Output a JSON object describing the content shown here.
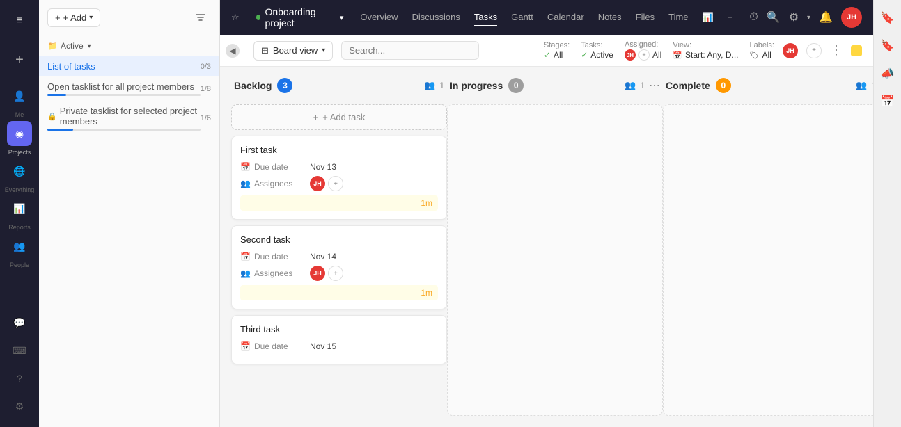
{
  "app": {
    "title": "Onboarding project"
  },
  "topNav": {
    "links": [
      {
        "id": "overview",
        "label": "Overview"
      },
      {
        "id": "discussions",
        "label": "Discussions"
      },
      {
        "id": "tasks",
        "label": "Tasks",
        "active": true
      },
      {
        "id": "gantt",
        "label": "Gantt"
      },
      {
        "id": "calendar",
        "label": "Calendar"
      },
      {
        "id": "notes",
        "label": "Notes"
      },
      {
        "id": "files",
        "label": "Files"
      },
      {
        "id": "time",
        "label": "Time"
      }
    ],
    "user": "JH"
  },
  "sidebar": {
    "addButton": "+ Add",
    "activeFilter": "Active",
    "items": [
      {
        "id": "list-of-tasks",
        "label": "List of tasks",
        "count": "0/3",
        "active": true,
        "locked": false
      },
      {
        "id": "open-tasklist",
        "label": "Open tasklist for all project members",
        "count": "1/8",
        "active": false,
        "locked": false
      },
      {
        "id": "private-tasklist",
        "label": "Private tasklist for selected project members",
        "count": "1/6",
        "active": false,
        "locked": true
      }
    ]
  },
  "board": {
    "viewLabel": "Board view",
    "searchPlaceholder": "Search...",
    "filters": {
      "stages": {
        "label": "Stages:",
        "value": "All"
      },
      "tasks": {
        "label": "Tasks:",
        "value": "Active"
      },
      "assigned": {
        "label": "Assigned:",
        "value": "All"
      },
      "view": {
        "label": "View:",
        "value": "Start: Any, D..."
      },
      "labels": {
        "label": "Labels:",
        "value": "All"
      }
    },
    "columns": [
      {
        "id": "backlog",
        "title": "Backlog",
        "count": 3,
        "badgeType": "blue",
        "members": 1,
        "tasks": [
          {
            "id": "task1",
            "title": "First task",
            "dueDate": "Nov 13",
            "assignees": "JH+",
            "time": "1m"
          },
          {
            "id": "task2",
            "title": "Second task",
            "dueDate": "Nov 14",
            "assignees": "JH+",
            "time": "1m"
          },
          {
            "id": "task3",
            "title": "Third task",
            "dueDate": "Nov 15",
            "assignees": "",
            "time": ""
          }
        ]
      },
      {
        "id": "in-progress",
        "title": "In progress",
        "count": 0,
        "badgeType": "gray",
        "members": 1,
        "tasks": []
      },
      {
        "id": "complete",
        "title": "Complete",
        "count": 0,
        "badgeType": "orange",
        "members": 1,
        "tasks": []
      }
    ]
  },
  "labels": {
    "dueDate": "Due date",
    "assignees": "Assignees",
    "addTask": "+ Add task",
    "taskCount03": "0/3",
    "taskCount18": "1/8",
    "taskCount16": "1/6"
  },
  "iconNav": {
    "items": [
      {
        "id": "menu",
        "icon": "≡",
        "label": ""
      },
      {
        "id": "me",
        "icon": "👤",
        "label": "Me"
      },
      {
        "id": "projects",
        "icon": "◉",
        "label": "Projects",
        "active": true
      },
      {
        "id": "everything",
        "icon": "🌐",
        "label": "Everything"
      },
      {
        "id": "reports",
        "icon": "📊",
        "label": "Reports"
      },
      {
        "id": "people",
        "icon": "👥",
        "label": "People"
      }
    ]
  }
}
